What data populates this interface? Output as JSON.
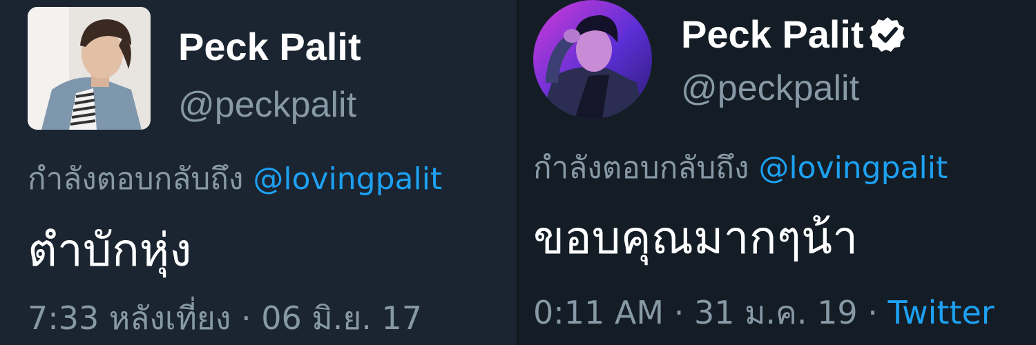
{
  "left_tweet": {
    "author": {
      "name": "Peck Palit",
      "handle": "@peckpalit",
      "verified": false
    },
    "reply_label": "กำลังตอบกลับถึง",
    "reply_to": "@lovingpalit",
    "text": "ตำบักหุ่ง",
    "time": "7:33 หลังเที่ยง",
    "separator": "·",
    "date": "06 มิ.ย. 17"
  },
  "right_tweet": {
    "author": {
      "name": "Peck Palit",
      "handle": "@peckpalit",
      "verified": true
    },
    "reply_label": "กำลังตอบกลับถึง",
    "reply_to": "@lovingpalit",
    "text": "ขอบคุณมากๆน้า",
    "time": "0:11 AM",
    "separator": "·",
    "date": "31 ม.ค. 19",
    "source": "Twitter"
  },
  "colors": {
    "left_background": "#1b2532",
    "right_background": "#141d26",
    "name": "#ffffff",
    "secondary_text": "#8899a6",
    "link": "#1da1f2"
  },
  "icons": {
    "verified": "verified-badge-icon"
  }
}
